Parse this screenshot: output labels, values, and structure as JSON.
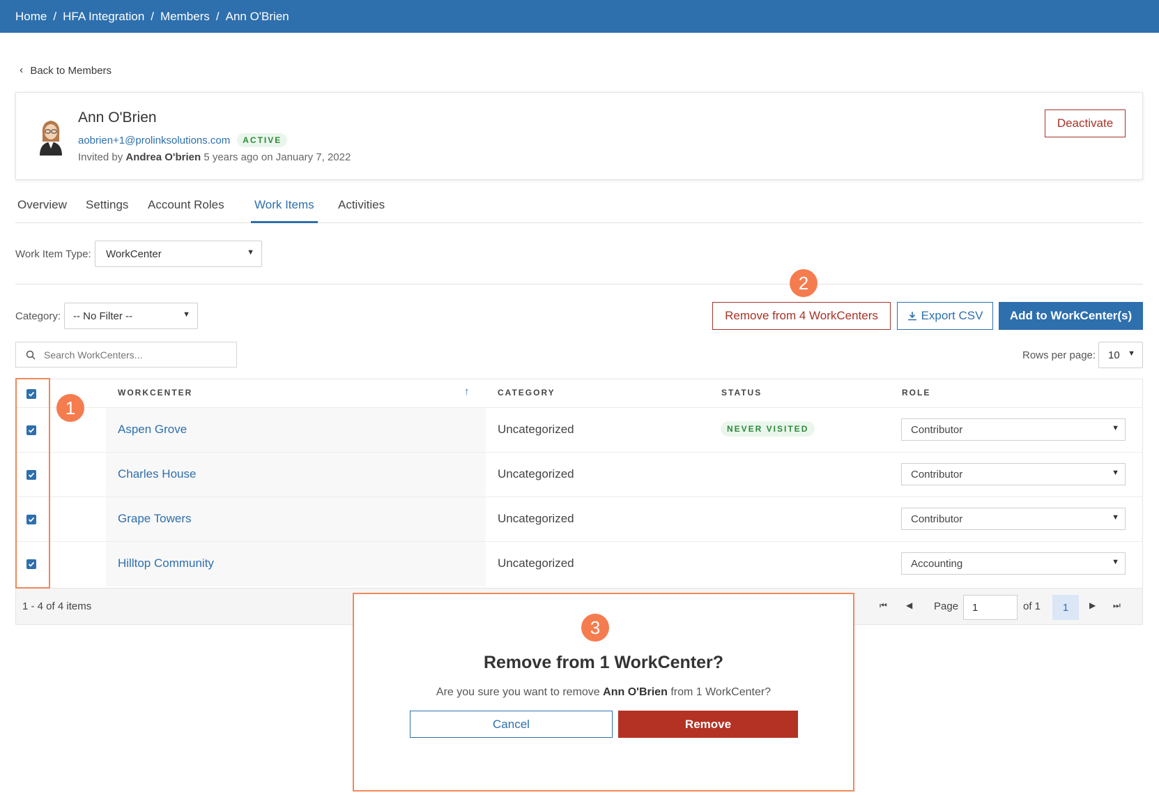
{
  "breadcrumb": {
    "items": [
      "Home",
      "HFA Integration",
      "Members",
      "Ann O'Brien"
    ],
    "separator": "/"
  },
  "back_link": {
    "label": "Back to Members"
  },
  "profile": {
    "name": "Ann O'Brien",
    "email": "aobrien+1@prolinksolutions.com",
    "status": "ACTIVE",
    "invited_prefix": "Invited by",
    "invited_by": "Andrea O'brien",
    "invited_suffix": "5 years ago on January 7, 2022",
    "deactivate_label": "Deactivate"
  },
  "tabs": [
    {
      "label": "Overview",
      "active": false
    },
    {
      "label": "Settings",
      "active": false
    },
    {
      "label": "Account Roles",
      "active": false
    },
    {
      "label": "Work Items",
      "active": true
    },
    {
      "label": "Activities",
      "active": false
    }
  ],
  "filters": {
    "work_item_type_label": "Work Item Type:",
    "work_item_type_value": "WorkCenter",
    "category_label": "Category:",
    "category_value": "-- No Filter --"
  },
  "actions": {
    "remove_label": "Remove from 4 WorkCenters",
    "export_label": "Export CSV",
    "add_label": "Add to WorkCenter(s)"
  },
  "search": {
    "placeholder": "Search WorkCenters..."
  },
  "rows_per_page": {
    "label": "Rows per page:",
    "value": "10"
  },
  "table": {
    "columns": [
      "WORKCENTER",
      "CATEGORY",
      "STATUS",
      "ROLE"
    ],
    "sort_indicator": "↑",
    "rows": [
      {
        "name": "Aspen Grove",
        "category": "Uncategorized",
        "status": "NEVER VISITED",
        "role": "Contributor",
        "checked": true
      },
      {
        "name": "Charles House",
        "category": "Uncategorized",
        "status": "",
        "role": "Contributor",
        "checked": true
      },
      {
        "name": "Grape Towers",
        "category": "Uncategorized",
        "status": "",
        "role": "Contributor",
        "checked": true
      },
      {
        "name": "Hilltop Community",
        "category": "Uncategorized",
        "status": "",
        "role": "Accounting",
        "checked": true
      }
    ]
  },
  "pagination": {
    "items_text": "1 - 4 of 4 items",
    "page_label": "Page",
    "page_value": "1",
    "of_label": "of 1",
    "current_page": "1"
  },
  "dialog": {
    "title": "Remove from 1 WorkCenter?",
    "msg_prefix": "Are you sure you want to remove",
    "msg_name": "Ann O'Brien",
    "msg_suffix": "from 1 WorkCenter?",
    "cancel_label": "Cancel",
    "remove_label": "Remove"
  },
  "annotations": {
    "marker_1": "1",
    "marker_2": "2",
    "marker_3": "3"
  },
  "colors": {
    "brand": "#2e6fad",
    "danger": "#a83226",
    "success": "#2c8a3a",
    "annotation": "#f57c4f"
  },
  "icons": {
    "back": "chevron-left-icon",
    "search": "search-icon",
    "export": "download-icon",
    "sort": "sort-ascending-icon",
    "pager_first": "first-page-icon",
    "pager_prev": "previous-page-icon",
    "pager_next": "next-page-icon",
    "pager_last": "last-page-icon"
  }
}
